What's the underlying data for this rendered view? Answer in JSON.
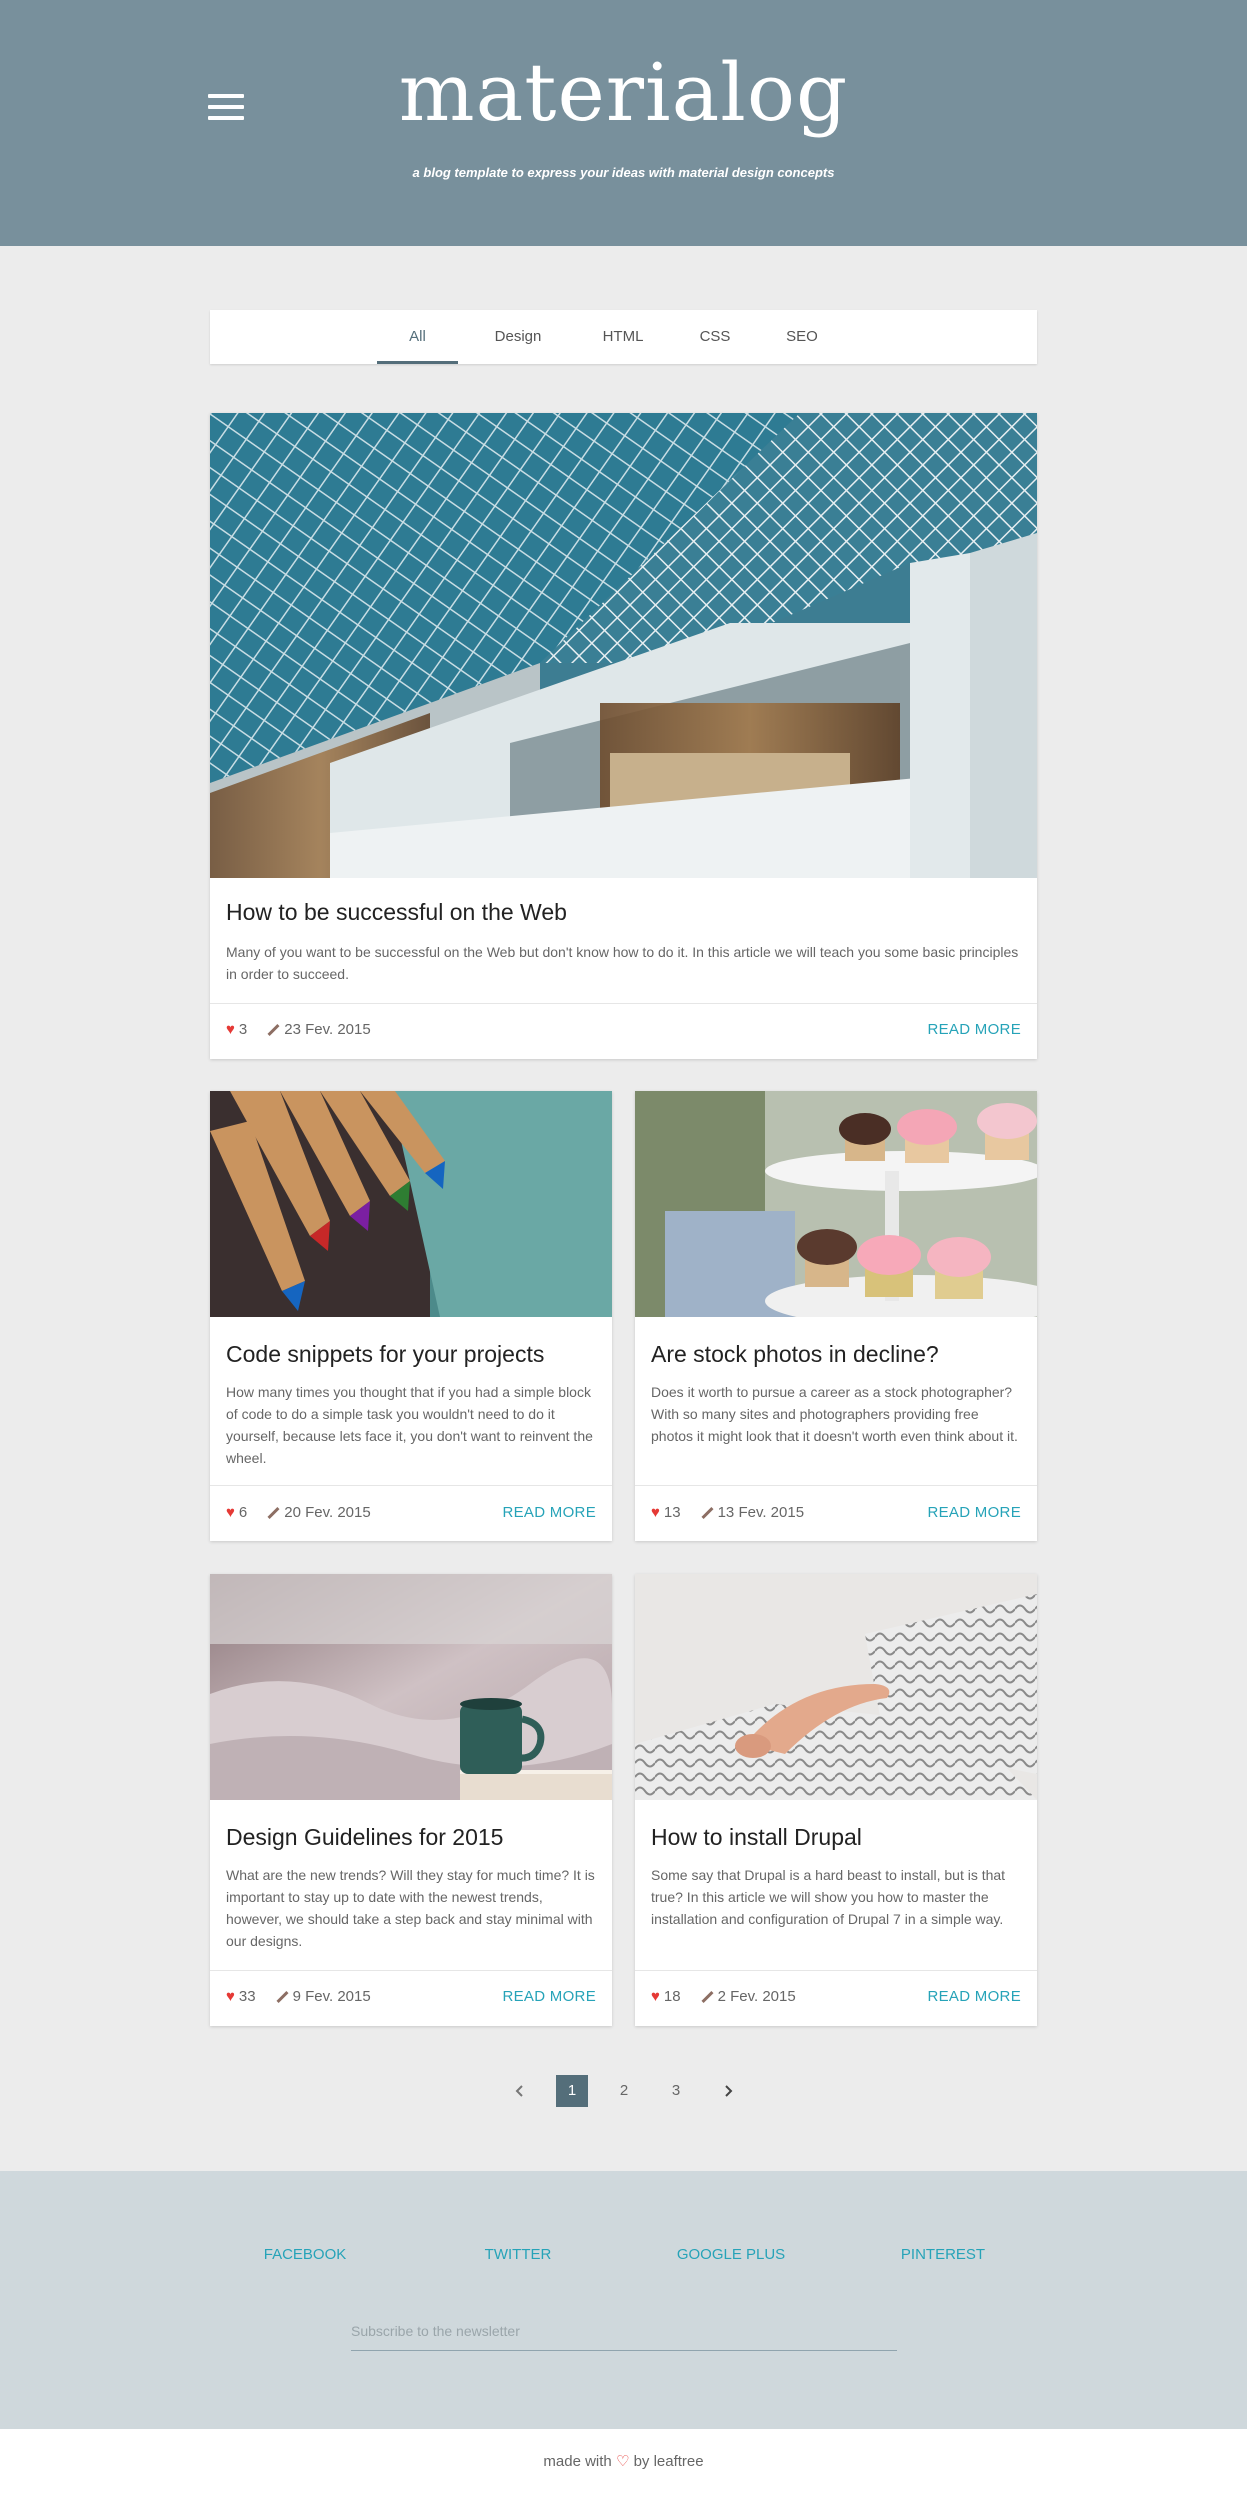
{
  "header": {
    "title": "materialog",
    "tagline": "a blog template to express your ideas with material design concepts"
  },
  "tabs": [
    {
      "label": "All",
      "active": true
    },
    {
      "label": "Design",
      "active": false
    },
    {
      "label": "HTML",
      "active": false
    },
    {
      "label": "CSS",
      "active": false
    },
    {
      "label": "SEO",
      "active": false
    }
  ],
  "posts": [
    {
      "title": "How to be successful on the Web",
      "excerpt": "Many of you want to be successful on the Web but don't know how to do it. In this article we will teach you some basic principles in order to succeed.",
      "likes": "3",
      "date": "23 Fev. 2015",
      "read_more": "READ MORE",
      "image": "library-architecture-photo"
    },
    {
      "title": "Code snippets for your projects",
      "excerpt": "How many times you thought that if you had a simple block of code to do a simple task you wouldn't need to do it yourself, because lets face it, you don't want to reinvent the wheel.",
      "likes": "6",
      "date": "20 Fev. 2015",
      "read_more": "READ MORE",
      "image": "colored-pencils-photo"
    },
    {
      "title": "Are stock photos in decline?",
      "excerpt": "Does it worth to pursue a career as a stock photographer? With so many sites and photographers providing free photos it might look that it doesn't worth even think about it.",
      "likes": "13",
      "date": "13 Fev. 2015",
      "read_more": "READ MORE",
      "image": "cupcakes-photo"
    },
    {
      "title": "Design Guidelines for 2015",
      "excerpt": "What are the new trends? Will they stay for much time? It is important to stay up to date with the newest trends, however, we should take a step back and stay minimal with our designs.",
      "likes": "33",
      "date": "9 Fev. 2015",
      "read_more": "READ MORE",
      "image": "coffee-mug-bed-photo"
    },
    {
      "title": "How to install Drupal",
      "excerpt": "Some say that Drupal is a hard beast to install, but is that true? In this article we will show you how to master the installation and configuration of Drupal 7 in a simple way.",
      "likes": "18",
      "date": "2 Fev. 2015",
      "read_more": "READ MORE",
      "image": "pillows-arm-photo"
    }
  ],
  "pagination": {
    "prev_icon": "chevron-left-icon",
    "pages": [
      "1",
      "2",
      "3"
    ],
    "current": "1",
    "next_icon": "chevron-right-icon"
  },
  "footer": {
    "social": [
      "FACEBOOK",
      "TWITTER",
      "GOOGLE PLUS",
      "PINTEREST"
    ],
    "newsletter_placeholder": "Subscribe to the newsletter",
    "made_with": "made with",
    "by": "by leaftree"
  },
  "colors": {
    "header_bg": "#78909c",
    "accent": "#26a3b8",
    "active_tab": "#546e7a",
    "heart": "#e53935",
    "footer_bg": "#cfd8dc"
  }
}
